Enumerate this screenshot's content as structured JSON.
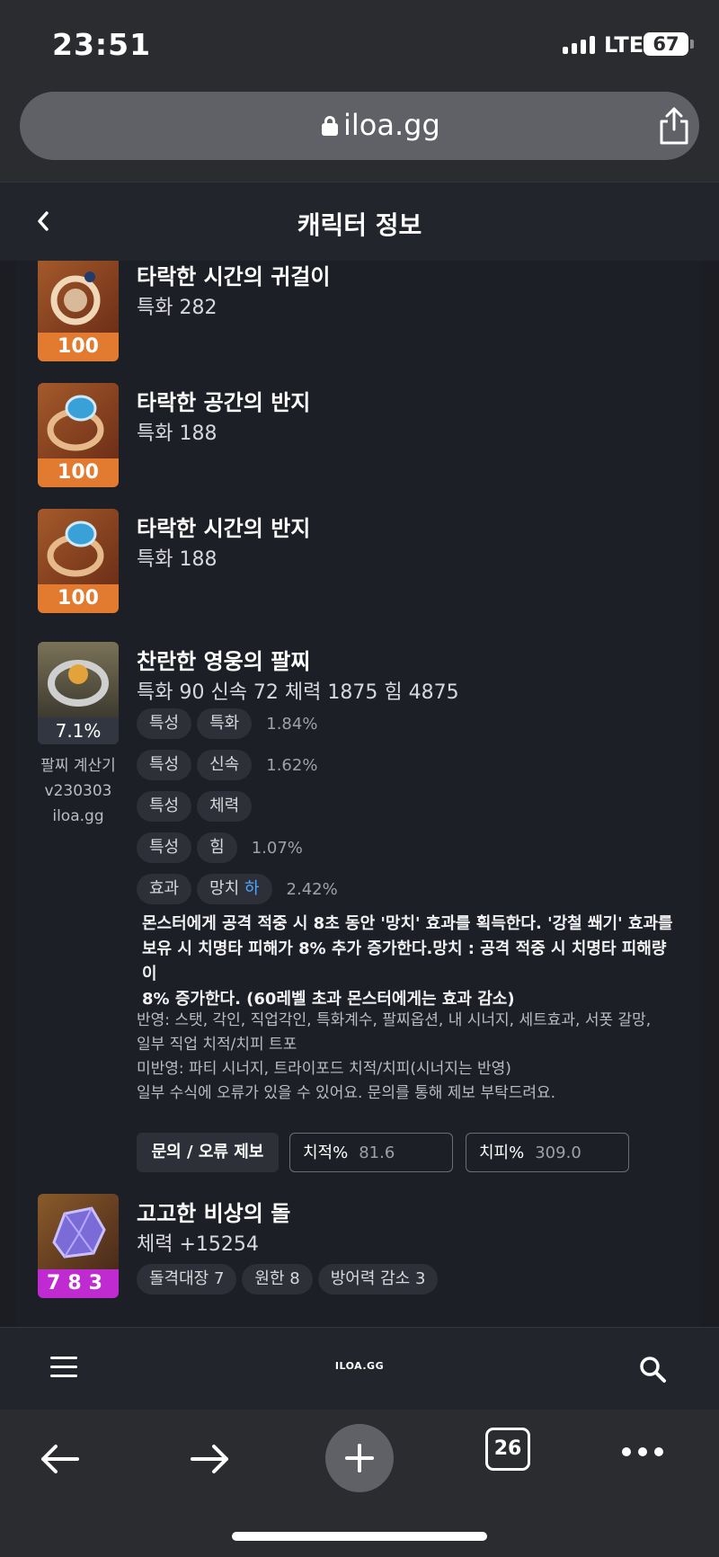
{
  "status": {
    "time": "23:51",
    "network": "LTE",
    "battery": "67"
  },
  "browser": {
    "url": "iloa.gg",
    "tab_count": "26"
  },
  "header": {
    "title": "캐릭터 정보"
  },
  "items": [
    {
      "name": "타락한 시간의 귀걸이",
      "stat": "특화 282",
      "level": "100"
    },
    {
      "name": "타락한 공간의 반지",
      "stat": "특화 188",
      "level": "100"
    },
    {
      "name": "타락한 시간의 반지",
      "stat": "특화 188",
      "level": "100"
    }
  ],
  "bracelet": {
    "name": "찬란한 영웅의 팔찌",
    "stat": "특화 90  신속 72  체력 1875  힘 4875",
    "percent": "7.1%",
    "calc_lines": [
      "팔찌 계산기",
      "v230303",
      "iloa.gg"
    ],
    "rows": [
      {
        "type": "특성",
        "name": "특화",
        "value": "1.84%"
      },
      {
        "type": "특성",
        "name": "신속",
        "value": "1.62%"
      },
      {
        "type": "특성",
        "name": "체력",
        "value": ""
      },
      {
        "type": "특성",
        "name": "힘",
        "value": "1.07%"
      },
      {
        "type": "효과",
        "name": "망치",
        "grade": "하",
        "value": "2.42%"
      }
    ],
    "description": [
      "몬스터에게 공격 적중 시 8초 동안 '망치' 효과를 획득한다. '강철 쐐기' 효과를",
      "보유 시 치명타 피해가 8% 추가 증가한다.망치 : 공격 적중 시 치명타 피해량이",
      "8% 증가한다. (60레벨 초과 몬스터에게는 효과 감소)"
    ],
    "notes": [
      "반영: 스탯, 각인, 직업각인, 특화계수, 팔찌옵션, 내 시너지, 세트효과, 서폿 갈망,",
      "일부 직업 치적/치피 트포",
      "미반영: 파티 시너지, 트라이포드 치적/치피(시너지는 반영)",
      "일부 수식에 오류가 있을 수 있어요. 문의를 통해 제보 부탁드려요."
    ],
    "inquiry_button": "문의 / 오류 제보",
    "crit_rate_label": "치적%",
    "crit_rate_value": "81.6",
    "crit_dmg_label": "치피%",
    "crit_dmg_value": "309.0"
  },
  "stone": {
    "name": "고고한 비상의 돌",
    "stat": "체력 +15254",
    "level": "783",
    "engravings": [
      "돌격대장 7",
      "원한 8",
      "방어력 감소 3"
    ]
  },
  "appnav": {
    "logo": "ILOA.GG"
  },
  "colors": {
    "level_orange": "#e27a2f",
    "level_purple": "#c02ad1",
    "highlight_blue": "#4ea7ff"
  },
  "icons": {
    "status": [
      "signal-icon",
      "battery-icon"
    ],
    "browser": [
      "lock-icon",
      "share-icon"
    ],
    "nav": [
      "back-chevron-icon",
      "menu-icon",
      "search-icon"
    ],
    "toolbar": [
      "back-arrow-icon",
      "forward-arrow-icon",
      "new-tab-icon",
      "tabs-icon",
      "more-icon"
    ]
  }
}
